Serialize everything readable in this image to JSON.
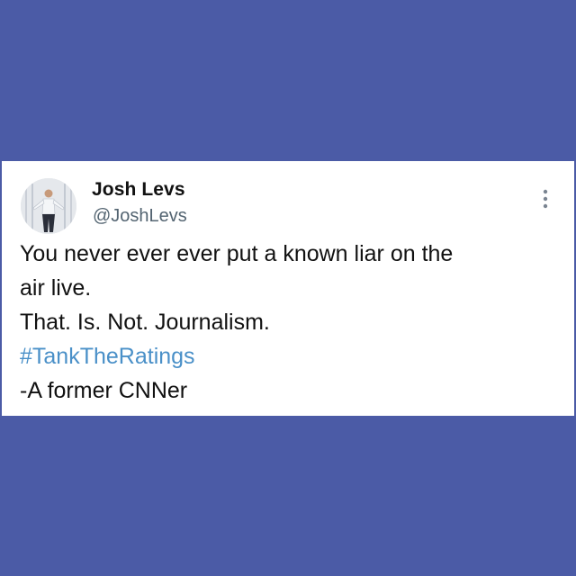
{
  "tweet": {
    "author": {
      "display_name": "Josh Levs",
      "handle": "@JoshLevs"
    },
    "menu_icon": "more-vertical-icon",
    "lines": [
      "You never ever ever put a known liar on the",
      "air live.",
      "That. Is. Not. Journalism."
    ],
    "hashtag": "#TankTheRatings",
    "signoff": "-A former CNNer"
  },
  "colors": {
    "background": "#4b5ba6",
    "card": "#ffffff",
    "text": "#111111",
    "handle": "#536471",
    "hashtag": "#4a90c8"
  }
}
